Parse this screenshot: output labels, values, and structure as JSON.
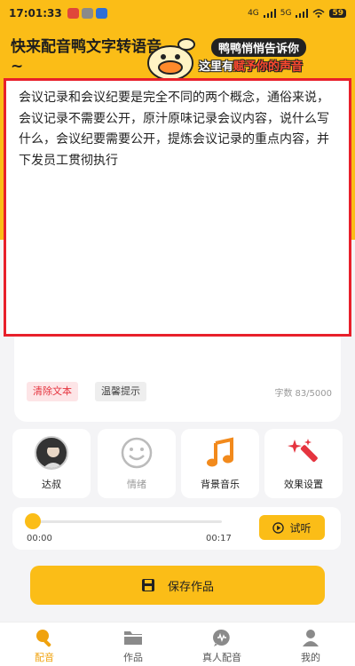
{
  "status": {
    "time": "17:01:33",
    "network": "4G",
    "network2": "5G",
    "battery": "59"
  },
  "header": {
    "title": "快来配音鸭文字转语音~",
    "banner_line1": "鸭鸭悄悄告诉你",
    "banner_line2_pre": "这里有",
    "banner_line2_highlight": "赋予你的声音"
  },
  "editor": {
    "text": "会议记录和会议纪要是完全不同的两个概念，通俗来说，会议记录不需要公开，原汁原味记录会议内容，说什么写什么，会议纪要需要公开，提炼会议记录的重点内容，并下发员工贯彻执行",
    "clear_label": "清除文本",
    "tips_label": "温馨提示",
    "count_label": "字数",
    "count_value": "83/5000"
  },
  "tiles": [
    {
      "label": "达叔",
      "icon": "voice-avatar"
    },
    {
      "label": "情绪",
      "icon": "smile-icon"
    },
    {
      "label": "背景音乐",
      "icon": "music-note-icon"
    },
    {
      "label": "效果设置",
      "icon": "magic-wand-icon"
    }
  ],
  "player": {
    "start": "00:00",
    "end": "00:17",
    "progress": 0.0,
    "listen_label": "试听"
  },
  "save_label": "保存作品",
  "tabs": [
    {
      "label": "配音",
      "active": true
    },
    {
      "label": "作品",
      "active": false
    },
    {
      "label": "真人配音",
      "active": false
    },
    {
      "label": "我的",
      "active": false
    }
  ],
  "colors": {
    "accent": "#fbbd17",
    "danger": "#e5343f",
    "highlight_border": "#e8202b"
  }
}
